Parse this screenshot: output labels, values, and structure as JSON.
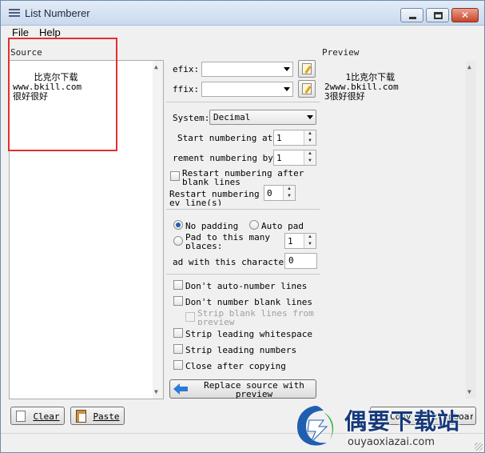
{
  "window": {
    "title": "List Numberer"
  },
  "menu": {
    "file": "File",
    "help": "Help"
  },
  "source": {
    "label": "Source",
    "text": "比克尔下载\nwww.bkill.com\n很好很好"
  },
  "preview": {
    "label": "Preview",
    "text": "1比克尔下载\n2www.bkill.com\n3很好很好"
  },
  "options": {
    "prefix_label": "efix:",
    "prefix_value": "",
    "suffix_label": "ffix:",
    "suffix_value": "",
    "system_label": "System:",
    "system_value": "Decimal",
    "start_label": "Start numbering at:",
    "start_value": "1",
    "increment_label": "rement numbering by:",
    "increment_value": "1",
    "restart_blank_label": "Restart numbering after blank lines",
    "restart_every_label": "Restart numbering ev line(s)",
    "restart_every_value": "0",
    "no_padding_label": "No padding",
    "auto_pad_label": "Auto pad",
    "pad_many_label": "Pad to this many places:",
    "pad_many_value": "1",
    "pad_char_label": "ad with this character:",
    "pad_char_value": "0",
    "dont_auto_label": "Don't auto-number lines",
    "dont_blank_label": "Don't number blank lines",
    "strip_blank_label": "Strip blank lines from preview",
    "strip_ws_label": "Strip leading whitespace",
    "strip_num_label": "Strip leading numbers",
    "close_copy_label": "Close after copying",
    "replace_label": "Replace source with preview"
  },
  "buttons": {
    "clear": "Clear",
    "paste": "Paste",
    "copy": "Copy to clipboard"
  },
  "watermark": {
    "cn": "偶要下载站",
    "en": "ouyaoxiazai.com"
  },
  "colors": {
    "highlight_box": "#e0302f",
    "accent": "#2a7bd8"
  }
}
